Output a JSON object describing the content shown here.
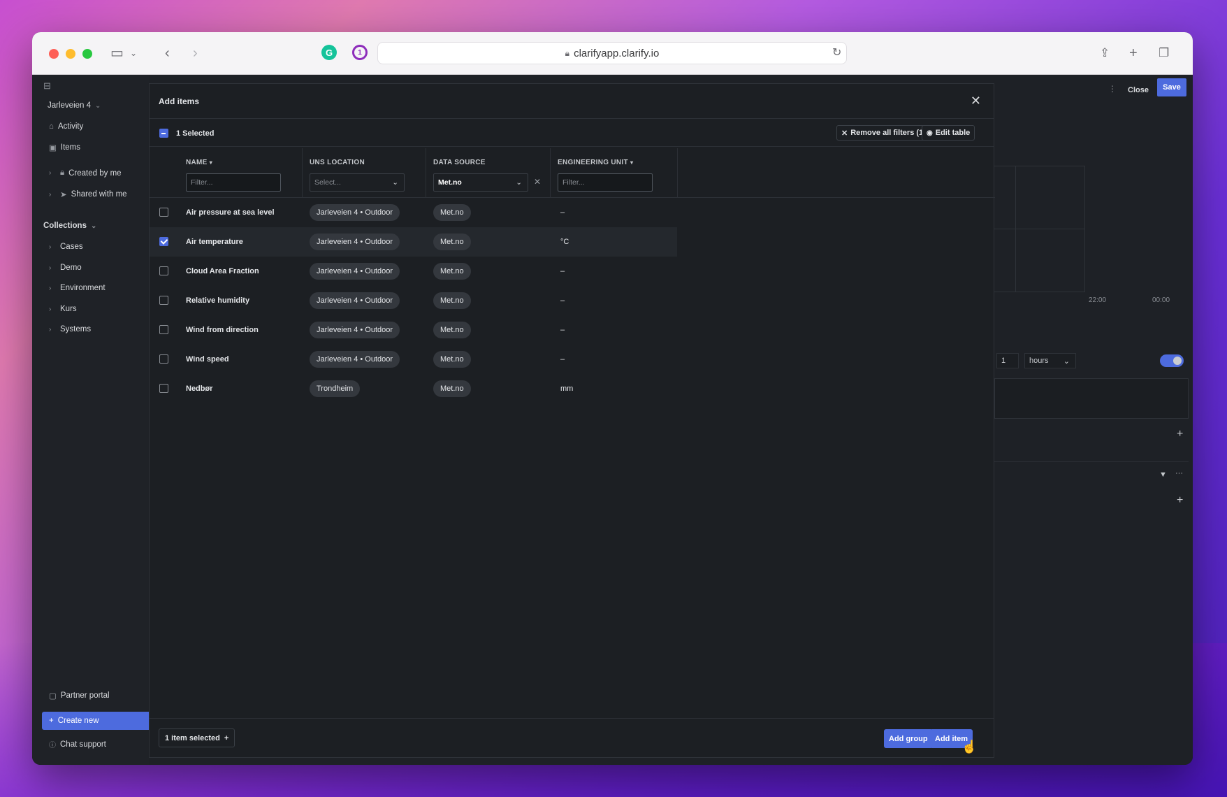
{
  "browser": {
    "url": "clarifyapp.clarify.io",
    "extensions": {
      "grammarly": "G",
      "onepassword": "1"
    }
  },
  "sidebar": {
    "org": "Jarleveien 4",
    "nav": [
      {
        "label": "Activity",
        "icon": "home-icon"
      },
      {
        "label": "Items",
        "icon": "image-icon"
      }
    ],
    "groups": [
      {
        "label": "Created by me",
        "icon": "lock-icon"
      },
      {
        "label": "Shared with me",
        "icon": "send-icon"
      }
    ],
    "collections_label": "Collections",
    "collections": [
      "Cases",
      "Demo",
      "Environment",
      "Kurs",
      "Systems"
    ],
    "partner_portal": "Partner portal",
    "create_new": "Create new",
    "chat_support": "Chat support"
  },
  "background": {
    "close": "Close",
    "save": "Save",
    "ticks": [
      "22:00",
      "00:00"
    ],
    "interval_value": "1",
    "interval_unit": "hours"
  },
  "dialog": {
    "title": "Add items",
    "selected_text": "1 Selected",
    "remove_filters": "Remove all filters (1)",
    "edit_table": "Edit table",
    "columns": {
      "name": "NAME",
      "uns_location": "UNS LOCATION",
      "data_source": "DATA SOURCE",
      "engineering_unit": "ENGINEERING UNIT"
    },
    "filters": {
      "name_placeholder": "Filter...",
      "location_placeholder": "Select...",
      "data_source_value": "Met.no",
      "unit_placeholder": "Filter..."
    },
    "rows": [
      {
        "name": "Air pressure at sea level",
        "location": "Jarleveien 4 • Outdoor",
        "source": "Met.no",
        "unit": "–",
        "checked": false
      },
      {
        "name": "Air temperature",
        "location": "Jarleveien 4 • Outdoor",
        "source": "Met.no",
        "unit": "°C",
        "checked": true
      },
      {
        "name": "Cloud Area Fraction",
        "location": "Jarleveien 4 • Outdoor",
        "source": "Met.no",
        "unit": "–",
        "checked": false
      },
      {
        "name": "Relative humidity",
        "location": "Jarleveien 4 • Outdoor",
        "source": "Met.no",
        "unit": "–",
        "checked": false
      },
      {
        "name": "Wind from direction",
        "location": "Jarleveien 4 • Outdoor",
        "source": "Met.no",
        "unit": "–",
        "checked": false
      },
      {
        "name": "Wind speed",
        "location": "Jarleveien 4 • Outdoor",
        "source": "Met.no",
        "unit": "–",
        "checked": false
      },
      {
        "name": "Nedbør",
        "location": "Trondheim",
        "source": "Met.no",
        "unit": "mm",
        "checked": false
      }
    ],
    "footer": {
      "item_selected": "1 item selected",
      "add_group": "Add group",
      "add_item": "Add item"
    }
  },
  "colors": {
    "accent": "#4d6bde",
    "panel": "#1c1f23",
    "chip": "#34383e"
  }
}
